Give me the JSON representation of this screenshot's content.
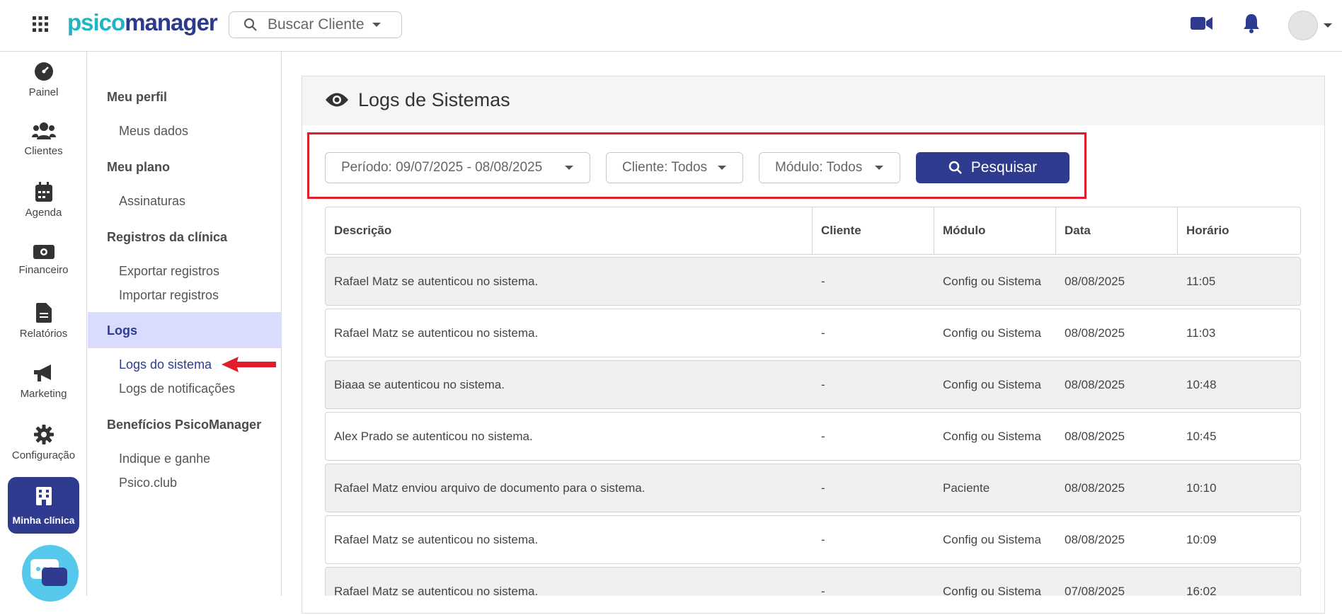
{
  "header": {
    "logo_part1": "psico",
    "logo_part2": "manager",
    "search_placeholder": "Buscar Cliente"
  },
  "leftnav": {
    "items": [
      {
        "label": "Painel",
        "icon": "gauge-icon"
      },
      {
        "label": "Clientes",
        "icon": "users-icon"
      },
      {
        "label": "Agenda",
        "icon": "calendar-icon"
      },
      {
        "label": "Financeiro",
        "icon": "money-icon"
      },
      {
        "label": "Relatórios",
        "icon": "file-icon"
      },
      {
        "label": "Marketing",
        "icon": "megaphone-icon"
      },
      {
        "label": "Configuração",
        "icon": "gear-icon"
      }
    ],
    "active": {
      "label": "Minha clínica",
      "icon": "building-icon"
    }
  },
  "submenu": {
    "sections": [
      {
        "title": "Meu perfil",
        "links": [
          "Meus dados"
        ]
      },
      {
        "title": "Meu plano",
        "links": [
          "Assinaturas"
        ]
      },
      {
        "title": "Registros da clínica",
        "links": [
          "Exportar registros",
          "Importar registros"
        ]
      },
      {
        "title": "Logs",
        "links": [
          "Logs do sistema",
          "Logs de notificações"
        ]
      },
      {
        "title": "Benefícios PsicoManager",
        "links": [
          "Indique e ganhe",
          "Psico.club"
        ]
      }
    ]
  },
  "panel": {
    "title": "Logs de Sistemas",
    "filters": {
      "period": "Período: 09/07/2025 - 08/08/2025",
      "client": "Cliente: Todos",
      "module": "Módulo: Todos",
      "search_button": "Pesquisar"
    },
    "table": {
      "headers": [
        "Descrição",
        "Cliente",
        "Módulo",
        "Data",
        "Horário"
      ],
      "rows": [
        [
          "Rafael Matz se autenticou no sistema.",
          "-",
          "Config ou Sistema",
          "08/08/2025",
          "11:05"
        ],
        [
          "Rafael Matz se autenticou no sistema.",
          "-",
          "Config ou Sistema",
          "08/08/2025",
          "11:03"
        ],
        [
          "Biaaa se autenticou no sistema.",
          "-",
          "Config ou Sistema",
          "08/08/2025",
          "10:48"
        ],
        [
          "Alex Prado se autenticou no sistema.",
          "-",
          "Config ou Sistema",
          "08/08/2025",
          "10:45"
        ],
        [
          "Rafael Matz enviou arquivo de documento para o sistema.",
          "-",
          "Paciente",
          "08/08/2025",
          "10:10"
        ],
        [
          "Rafael Matz se autenticou no sistema.",
          "-",
          "Config ou Sistema",
          "08/08/2025",
          "10:09"
        ],
        [
          "Rafael Matz se autenticou no sistema.",
          "-",
          "Config ou Sistema",
          "07/08/2025",
          "16:02"
        ]
      ]
    }
  },
  "colors": {
    "primary": "#2e3b8e",
    "accent": "#1fb5c6",
    "highlight": "#e01e2b",
    "active_menu_bg": "#d9dbff"
  }
}
